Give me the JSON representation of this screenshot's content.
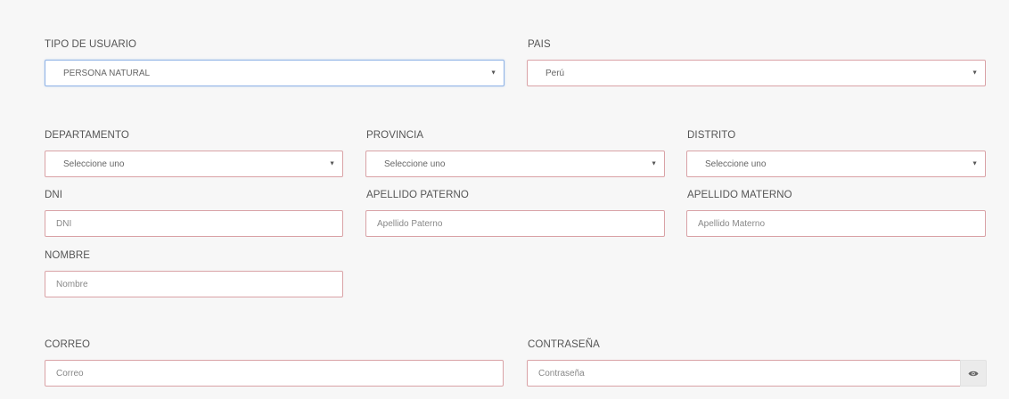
{
  "form": {
    "tipo_usuario": {
      "label": "TIPO DE USUARIO",
      "value": "PERSONA NATURAL"
    },
    "pais": {
      "label": "PAIS",
      "value": "Perú"
    },
    "departamento": {
      "label": "DEPARTAMENTO",
      "value": "Seleccione uno"
    },
    "provincia": {
      "label": "PROVINCIA",
      "value": "Seleccione uno"
    },
    "distrito": {
      "label": "DISTRITO",
      "value": "Seleccione uno"
    },
    "dni": {
      "label": "DNI",
      "placeholder": "DNI"
    },
    "apellido_paterno": {
      "label": "APELLIDO PATERNO",
      "placeholder": "Apellido Paterno"
    },
    "apellido_materno": {
      "label": "APELLIDO MATERNO",
      "placeholder": "Apellido Materno"
    },
    "nombre": {
      "label": "NOMBRE",
      "placeholder": "Nombre"
    },
    "correo": {
      "label": "CORREO",
      "placeholder": "Correo"
    },
    "contrasena": {
      "label": "CONTRASEÑA",
      "placeholder": "Contraseña",
      "toggle_icon": "eye-icon"
    }
  },
  "colors": {
    "field_border": "#d9a2a6",
    "active_border": "#8fb3e6",
    "background": "#f7f7f7"
  }
}
